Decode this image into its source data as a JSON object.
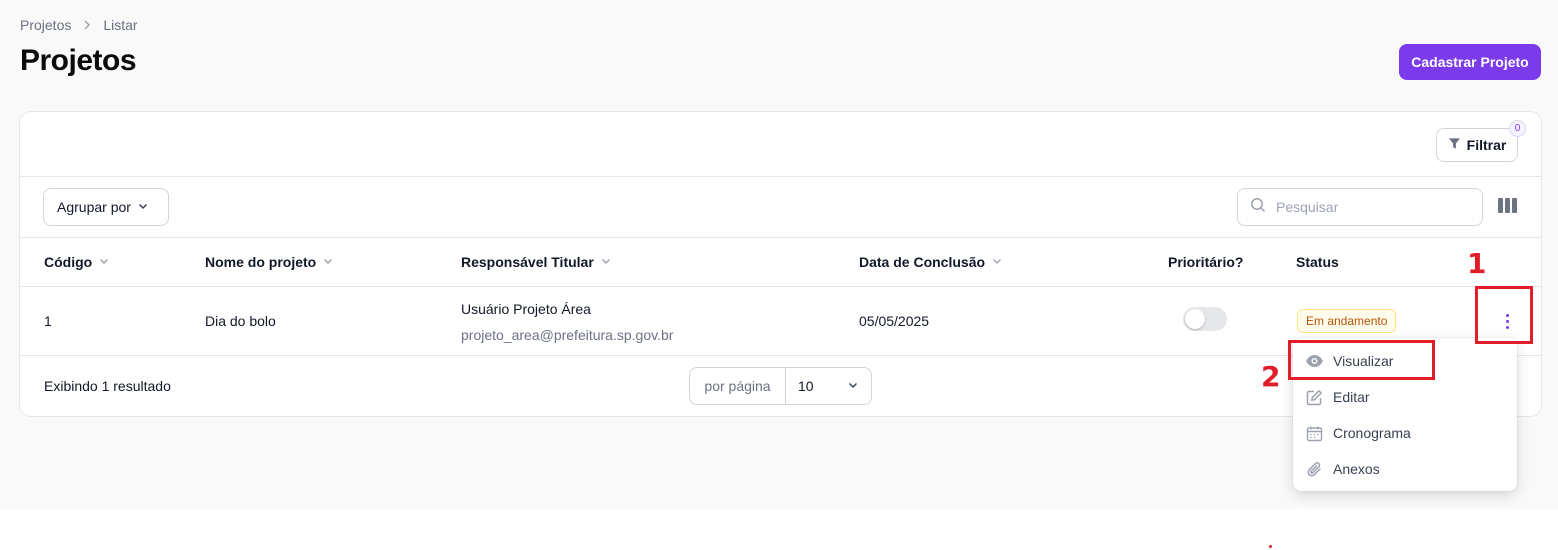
{
  "breadcrumb": {
    "items": [
      "Projetos",
      "Listar"
    ]
  },
  "header": {
    "title": "Projetos",
    "create_button": "Cadastrar Projeto"
  },
  "toolbar": {
    "filter_label": "Filtrar",
    "filter_count": "0",
    "group_by_label": "Agrupar por",
    "search_placeholder": "Pesquisar"
  },
  "table": {
    "columns": [
      "Código",
      "Nome do projeto",
      "Responsável Titular",
      "Data de Conclusão",
      "Prioritário?",
      "Status"
    ],
    "rows": [
      {
        "codigo": "1",
        "nome": "Dia do bolo",
        "responsavel_nome": "Usuário Projeto Área",
        "responsavel_email": "projeto_area@prefeitura.sp.gov.br",
        "data_conclusao": "05/05/2025",
        "prioritario": false,
        "status": "Em andamento"
      }
    ]
  },
  "footer": {
    "results_text": "Exibindo 1 resultado",
    "per_page_label": "por página",
    "per_page_value": "10"
  },
  "row_menu": {
    "items": [
      {
        "label": "Visualizar",
        "icon": "eye-icon"
      },
      {
        "label": "Editar",
        "icon": "pencil-square-icon"
      },
      {
        "label": "Cronograma",
        "icon": "calendar-icon"
      },
      {
        "label": "Anexos",
        "icon": "paperclip-icon"
      }
    ]
  },
  "annotations": {
    "step1": "1",
    "step2": "2"
  },
  "colors": {
    "primary": "#7c3aed",
    "annotation": "#e11d2a",
    "status_warning_text": "#b45309"
  }
}
